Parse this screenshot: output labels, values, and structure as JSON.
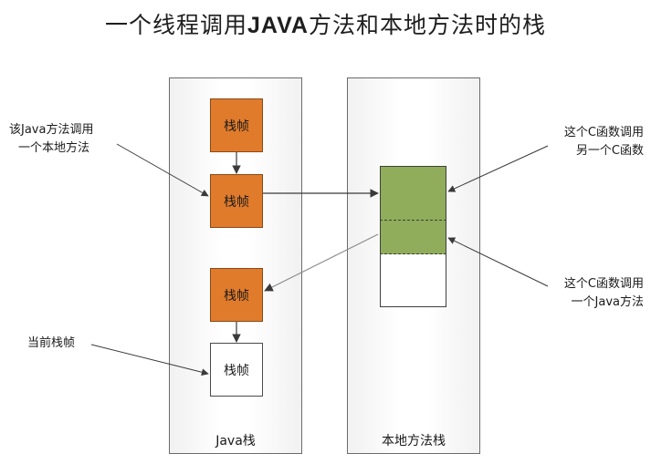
{
  "title": {
    "prefix": "一个线程调用",
    "bold": "JAVA",
    "suffix": "方法和本地方法时的栈"
  },
  "java_stack": {
    "label": "Java栈",
    "frames": [
      "栈帧",
      "栈帧",
      "栈帧",
      "栈帧"
    ]
  },
  "native_stack": {
    "label": "本地方法栈"
  },
  "notes": {
    "java_calls_native": [
      "该Java方法调用",
      "一个本地方法"
    ],
    "current_frame": "当前栈帧",
    "c_calls_c": [
      "这个C函数调用",
      "另一个C函数"
    ],
    "c_calls_java": [
      "这个C函数调用",
      "一个Java方法"
    ]
  },
  "colors": {
    "frame_fill": "#e07b2c",
    "native_block_fill": "#8fad5a",
    "panel_border": "#6b6b6b"
  }
}
